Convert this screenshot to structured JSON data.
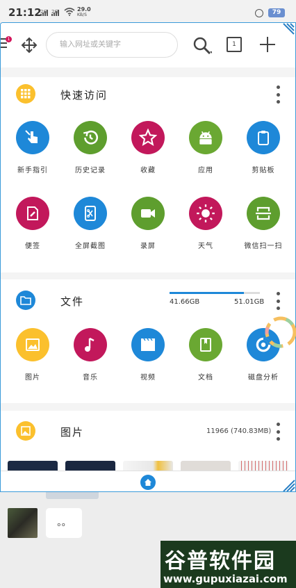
{
  "status_bar": {
    "time": "21:12",
    "signal_1": "2G",
    "signal_2": "2G",
    "speed_value": "29.0",
    "speed_unit": "KB/S",
    "battery": "79"
  },
  "toolbar": {
    "menu_badge": "1",
    "search_placeholder": "输入网址或关键字",
    "tabs_count": "1"
  },
  "quick_access": {
    "title": "快速访问",
    "items": [
      {
        "label": "新手指引",
        "icon": "hand-pointer-icon",
        "color": "#1e88d8"
      },
      {
        "label": "历史记录",
        "icon": "history-icon",
        "color": "#5e9e2e"
      },
      {
        "label": "收藏",
        "icon": "star-icon",
        "color": "#c2185b"
      },
      {
        "label": "应用",
        "icon": "android-icon",
        "color": "#6aa832"
      },
      {
        "label": "剪贴板",
        "icon": "clipboard-icon",
        "color": "#1e88d8"
      },
      {
        "label": "便签",
        "icon": "note-edit-icon",
        "color": "#c2185b"
      },
      {
        "label": "全屏截图",
        "icon": "screenshot-icon",
        "color": "#1e88d8"
      },
      {
        "label": "录屏",
        "icon": "video-camera-icon",
        "color": "#5e9e2e"
      },
      {
        "label": "天气",
        "icon": "sun-icon",
        "color": "#c2185b"
      },
      {
        "label": "微信扫一扫",
        "icon": "scan-icon",
        "color": "#5e9e2e"
      }
    ]
  },
  "files": {
    "title": "文件",
    "used": "41.66GB",
    "total": "51.01GB",
    "used_fraction": 0.82,
    "items": [
      {
        "label": "图片",
        "icon": "image-icon",
        "color": "#fbc02d"
      },
      {
        "label": "音乐",
        "icon": "music-note-icon",
        "color": "#c2185b"
      },
      {
        "label": "视频",
        "icon": "film-icon",
        "color": "#1e88d8"
      },
      {
        "label": "文档",
        "icon": "document-icon",
        "color": "#6aa832"
      },
      {
        "label": "磁盘分析",
        "icon": "disk-chart-icon",
        "color": "#1e88d8"
      }
    ]
  },
  "pictures": {
    "title": "图片",
    "count": "11966 (740.83MB)"
  },
  "chat": {
    "message": "。。"
  },
  "watermark": {
    "cn": "谷普软件园",
    "url": "www.gupuxiazai.com"
  }
}
